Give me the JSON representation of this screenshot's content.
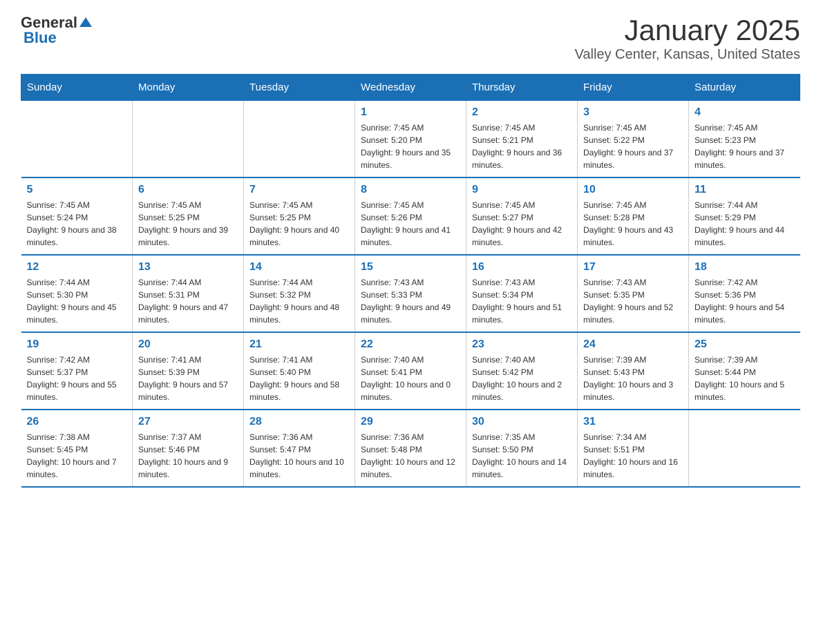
{
  "header": {
    "logo_general": "General",
    "logo_blue": "Blue",
    "month_title": "January 2025",
    "location": "Valley Center, Kansas, United States"
  },
  "days_of_week": [
    "Sunday",
    "Monday",
    "Tuesday",
    "Wednesday",
    "Thursday",
    "Friday",
    "Saturday"
  ],
  "weeks": [
    [
      {
        "day": "",
        "info": ""
      },
      {
        "day": "",
        "info": ""
      },
      {
        "day": "",
        "info": ""
      },
      {
        "day": "1",
        "info": "Sunrise: 7:45 AM\nSunset: 5:20 PM\nDaylight: 9 hours and 35 minutes."
      },
      {
        "day": "2",
        "info": "Sunrise: 7:45 AM\nSunset: 5:21 PM\nDaylight: 9 hours and 36 minutes."
      },
      {
        "day": "3",
        "info": "Sunrise: 7:45 AM\nSunset: 5:22 PM\nDaylight: 9 hours and 37 minutes."
      },
      {
        "day": "4",
        "info": "Sunrise: 7:45 AM\nSunset: 5:23 PM\nDaylight: 9 hours and 37 minutes."
      }
    ],
    [
      {
        "day": "5",
        "info": "Sunrise: 7:45 AM\nSunset: 5:24 PM\nDaylight: 9 hours and 38 minutes."
      },
      {
        "day": "6",
        "info": "Sunrise: 7:45 AM\nSunset: 5:25 PM\nDaylight: 9 hours and 39 minutes."
      },
      {
        "day": "7",
        "info": "Sunrise: 7:45 AM\nSunset: 5:25 PM\nDaylight: 9 hours and 40 minutes."
      },
      {
        "day": "8",
        "info": "Sunrise: 7:45 AM\nSunset: 5:26 PM\nDaylight: 9 hours and 41 minutes."
      },
      {
        "day": "9",
        "info": "Sunrise: 7:45 AM\nSunset: 5:27 PM\nDaylight: 9 hours and 42 minutes."
      },
      {
        "day": "10",
        "info": "Sunrise: 7:45 AM\nSunset: 5:28 PM\nDaylight: 9 hours and 43 minutes."
      },
      {
        "day": "11",
        "info": "Sunrise: 7:44 AM\nSunset: 5:29 PM\nDaylight: 9 hours and 44 minutes."
      }
    ],
    [
      {
        "day": "12",
        "info": "Sunrise: 7:44 AM\nSunset: 5:30 PM\nDaylight: 9 hours and 45 minutes."
      },
      {
        "day": "13",
        "info": "Sunrise: 7:44 AM\nSunset: 5:31 PM\nDaylight: 9 hours and 47 minutes."
      },
      {
        "day": "14",
        "info": "Sunrise: 7:44 AM\nSunset: 5:32 PM\nDaylight: 9 hours and 48 minutes."
      },
      {
        "day": "15",
        "info": "Sunrise: 7:43 AM\nSunset: 5:33 PM\nDaylight: 9 hours and 49 minutes."
      },
      {
        "day": "16",
        "info": "Sunrise: 7:43 AM\nSunset: 5:34 PM\nDaylight: 9 hours and 51 minutes."
      },
      {
        "day": "17",
        "info": "Sunrise: 7:43 AM\nSunset: 5:35 PM\nDaylight: 9 hours and 52 minutes."
      },
      {
        "day": "18",
        "info": "Sunrise: 7:42 AM\nSunset: 5:36 PM\nDaylight: 9 hours and 54 minutes."
      }
    ],
    [
      {
        "day": "19",
        "info": "Sunrise: 7:42 AM\nSunset: 5:37 PM\nDaylight: 9 hours and 55 minutes."
      },
      {
        "day": "20",
        "info": "Sunrise: 7:41 AM\nSunset: 5:39 PM\nDaylight: 9 hours and 57 minutes."
      },
      {
        "day": "21",
        "info": "Sunrise: 7:41 AM\nSunset: 5:40 PM\nDaylight: 9 hours and 58 minutes."
      },
      {
        "day": "22",
        "info": "Sunrise: 7:40 AM\nSunset: 5:41 PM\nDaylight: 10 hours and 0 minutes."
      },
      {
        "day": "23",
        "info": "Sunrise: 7:40 AM\nSunset: 5:42 PM\nDaylight: 10 hours and 2 minutes."
      },
      {
        "day": "24",
        "info": "Sunrise: 7:39 AM\nSunset: 5:43 PM\nDaylight: 10 hours and 3 minutes."
      },
      {
        "day": "25",
        "info": "Sunrise: 7:39 AM\nSunset: 5:44 PM\nDaylight: 10 hours and 5 minutes."
      }
    ],
    [
      {
        "day": "26",
        "info": "Sunrise: 7:38 AM\nSunset: 5:45 PM\nDaylight: 10 hours and 7 minutes."
      },
      {
        "day": "27",
        "info": "Sunrise: 7:37 AM\nSunset: 5:46 PM\nDaylight: 10 hours and 9 minutes."
      },
      {
        "day": "28",
        "info": "Sunrise: 7:36 AM\nSunset: 5:47 PM\nDaylight: 10 hours and 10 minutes."
      },
      {
        "day": "29",
        "info": "Sunrise: 7:36 AM\nSunset: 5:48 PM\nDaylight: 10 hours and 12 minutes."
      },
      {
        "day": "30",
        "info": "Sunrise: 7:35 AM\nSunset: 5:50 PM\nDaylight: 10 hours and 14 minutes."
      },
      {
        "day": "31",
        "info": "Sunrise: 7:34 AM\nSunset: 5:51 PM\nDaylight: 10 hours and 16 minutes."
      },
      {
        "day": "",
        "info": ""
      }
    ]
  ]
}
